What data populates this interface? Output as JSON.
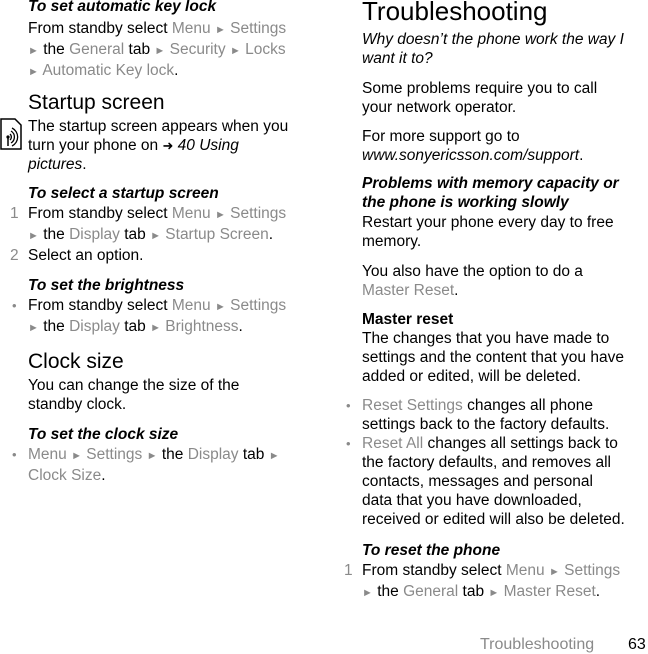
{
  "left_column": {
    "auto_key_lock": {
      "heading": "To set automatic key lock",
      "line1_pre": "From standby select ",
      "menu": "Menu",
      "settings": "Settings",
      "the": "the",
      "general": "General",
      "tab": "tab",
      "security": "Security",
      "locks": "Locks",
      "automatic_key_lock": "Automatic Key lock"
    },
    "startup_screen": {
      "title": "Startup screen",
      "body_1": "The startup screen appears when you",
      "body_2_pre": "turn your phone on ",
      "ref_page": "40 Using",
      "ref_title_2": "pictures",
      "icon": "network-service-icon",
      "arrow_icon": "reference-arrow-icon"
    },
    "select_startup": {
      "heading": "To select a startup screen",
      "step1_num": "1",
      "step1_pre": "From standby select ",
      "menu": "Menu",
      "settings": "Settings",
      "the": "the",
      "display": "Display",
      "tab": "tab",
      "startup_screen": "Startup Screen",
      "step2_num": "2",
      "step2": "Select an option."
    },
    "brightness": {
      "heading": "To set the brightness",
      "bullet": "•",
      "pre": "From standby select ",
      "menu": "Menu",
      "settings": "Settings",
      "the": "the",
      "display": "Display",
      "tab": "tab",
      "brightness": "Brightness"
    },
    "clock_size": {
      "title": "Clock size",
      "body_1": "You can change the size of the",
      "body_2": "standby clock.",
      "heading": "To set the clock size",
      "bullet": "•",
      "menu": "Menu",
      "settings": "Settings",
      "the": "the",
      "display": "Display",
      "tab": "tab",
      "clock_size": "Clock Size"
    }
  },
  "right_column": {
    "title": "Troubleshooting",
    "question_1": "Why doesn’t the phone work the way I",
    "question_2": "want it to?",
    "p1_1": "Some problems require you to call",
    "p1_2": "your network operator.",
    "p2_1": "For more support go to",
    "p2_url": "www.sonyericsson.com/support",
    "memory": {
      "heading_1": "Problems with memory capacity or",
      "heading_2": "the phone is working slowly",
      "body_1": "Restart your phone every day to free",
      "body_2": "memory.",
      "option_1": "You also have the option to do a",
      "option_link": "Master Reset"
    },
    "master_reset": {
      "heading": "Master reset",
      "body_1": "The changes that you have made to",
      "body_2": "settings and the content that you have",
      "body_3": "added or edited, will be deleted.",
      "bullets": [
        {
          "term": "Reset Settings",
          "lines": [
            " changes all phone",
            "settings back to the factory defaults."
          ]
        },
        {
          "term": "Reset All",
          "lines": [
            " changes all settings back to",
            "the factory defaults, and removes all",
            "contacts, messages and personal",
            "data that you have downloaded,",
            "received or edited will also be deleted."
          ]
        }
      ]
    },
    "reset_phone": {
      "heading": "To reset the phone",
      "step1_num": "1",
      "pre": "From standby select ",
      "menu": "Menu",
      "settings": "Settings",
      "the": "the",
      "general": "General",
      "tab": "tab",
      "master_reset": "Master Reset"
    }
  },
  "footer": {
    "section": "Troubleshooting",
    "page": "63"
  },
  "glyphs": {
    "arrow": "►",
    "bullet": "•",
    "period": "."
  }
}
